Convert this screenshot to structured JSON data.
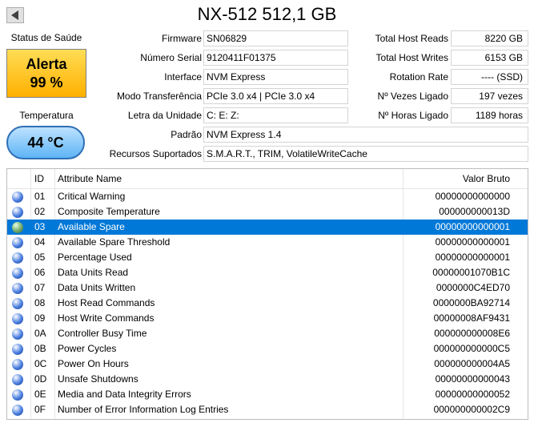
{
  "title": "NX-512 512,1 GB",
  "health": {
    "label": "Status de Saúde",
    "status": "Alerta",
    "percent": "99 %"
  },
  "temperature": {
    "label": "Temperatura",
    "value": "44 °C"
  },
  "info_left": [
    {
      "label": "Firmware",
      "value": "SN06829"
    },
    {
      "label": "Número Serial",
      "value": "9120411F01375"
    },
    {
      "label": "Interface",
      "value": "NVM Express"
    },
    {
      "label": "Modo Transferência",
      "value": "PCIe 3.0 x4 | PCIe 3.0 x4"
    },
    {
      "label": "Letra da Unidade",
      "value": "C: E: Z:"
    },
    {
      "label": "Padrão",
      "value": "NVM Express 1.4"
    },
    {
      "label": "Recursos Suportados",
      "value": "S.M.A.R.T., TRIM, VolatileWriteCache"
    }
  ],
  "info_right": [
    {
      "label": "Total Host Reads",
      "value": "8220 GB"
    },
    {
      "label": "Total Host Writes",
      "value": "6153 GB"
    },
    {
      "label": "Rotation Rate",
      "value": "---- (SSD)"
    },
    {
      "label": "Nº Vezes Ligado",
      "value": "197 vezes"
    },
    {
      "label": "Nº Horas Ligado",
      "value": "1189 horas"
    }
  ],
  "table": {
    "headers": {
      "id": "ID",
      "name": "Attribute Name",
      "raw": "Valor Bruto"
    },
    "rows": [
      {
        "id": "01",
        "name": "Critical Warning",
        "raw": "00000000000000",
        "status": "good",
        "selected": false
      },
      {
        "id": "02",
        "name": "Composite Temperature",
        "raw": "000000000013D",
        "status": "good",
        "selected": false
      },
      {
        "id": "03",
        "name": "Available Spare",
        "raw": "00000000000001",
        "status": "caution",
        "selected": true
      },
      {
        "id": "04",
        "name": "Available Spare Threshold",
        "raw": "00000000000001",
        "status": "good",
        "selected": false
      },
      {
        "id": "05",
        "name": "Percentage Used",
        "raw": "00000000000001",
        "status": "good",
        "selected": false
      },
      {
        "id": "06",
        "name": "Data Units Read",
        "raw": "00000001070B1C",
        "status": "good",
        "selected": false
      },
      {
        "id": "07",
        "name": "Data Units Written",
        "raw": "0000000C4ED70",
        "status": "good",
        "selected": false
      },
      {
        "id": "08",
        "name": "Host Read Commands",
        "raw": "0000000BA92714",
        "status": "good",
        "selected": false
      },
      {
        "id": "09",
        "name": "Host Write Commands",
        "raw": "00000008AF9431",
        "status": "good",
        "selected": false
      },
      {
        "id": "0A",
        "name": "Controller Busy Time",
        "raw": "000000000008E6",
        "status": "good",
        "selected": false
      },
      {
        "id": "0B",
        "name": "Power Cycles",
        "raw": "000000000000C5",
        "status": "good",
        "selected": false
      },
      {
        "id": "0C",
        "name": "Power On Hours",
        "raw": "000000000004A5",
        "status": "good",
        "selected": false
      },
      {
        "id": "0D",
        "name": "Unsafe Shutdowns",
        "raw": "00000000000043",
        "status": "good",
        "selected": false
      },
      {
        "id": "0E",
        "name": "Media and Data Integrity Errors",
        "raw": "00000000000052",
        "status": "good",
        "selected": false
      },
      {
        "id": "0F",
        "name": "Number of Error Information Log Entries",
        "raw": "000000000002C9",
        "status": "good",
        "selected": false
      }
    ]
  },
  "colors": {
    "good": "#4a7fe0",
    "caution": "#6fa86a",
    "selection": "#0078d7"
  },
  "icons": {
    "back": "triangle-left-icon",
    "status_dot": "status-dot-icon"
  }
}
